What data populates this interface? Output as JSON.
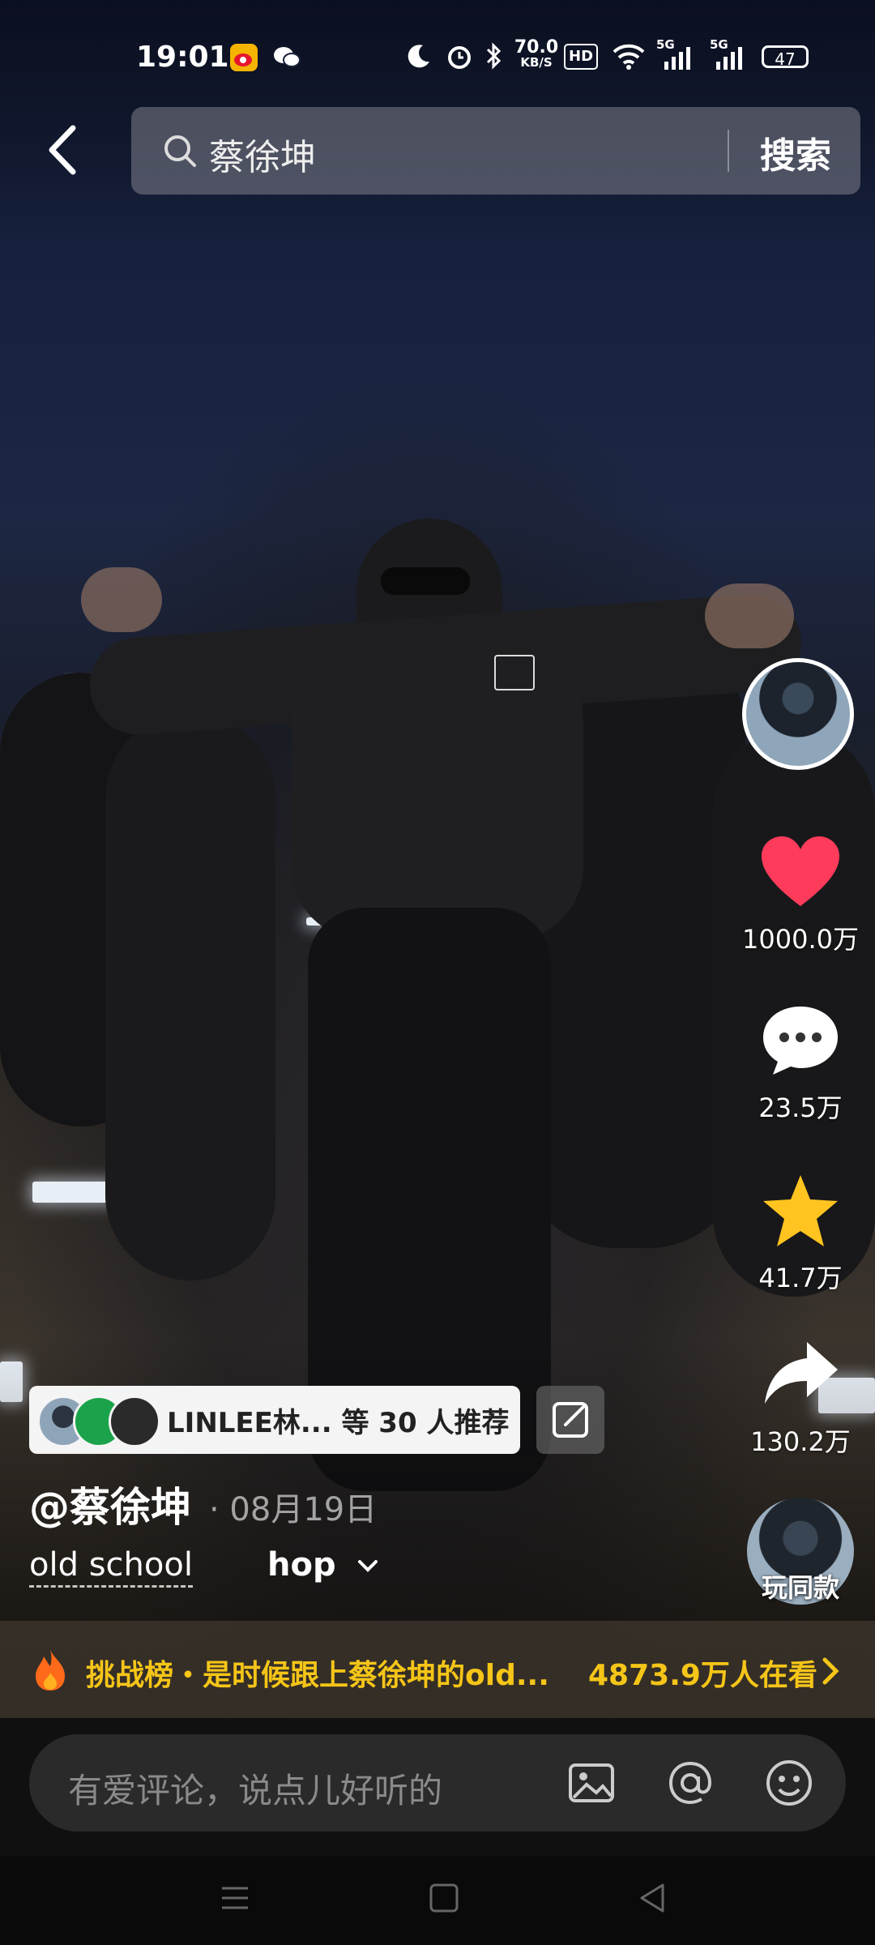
{
  "status_bar": {
    "time": "19:01",
    "net_speed_value": "70.0",
    "net_speed_unit": "KB/S",
    "hd_badge": "HD",
    "signal1": "5G",
    "signal2": "5G",
    "battery": "47",
    "icons": [
      "weibo-icon",
      "wechat-icon",
      "moon-icon",
      "alarm-icon",
      "bluetooth-icon",
      "wifi-icon",
      "signal-icon"
    ]
  },
  "search": {
    "query": "蔡徐坤",
    "button_label": "搜索"
  },
  "actions": {
    "likes": "1000.0万",
    "comments": "23.5万",
    "favorites": "41.7万",
    "shares": "130.2万"
  },
  "colors": {
    "like": "#ff3b5c",
    "favorite": "#ffc41f",
    "banner_text": "#f5c518"
  },
  "recommend": {
    "text": "LINLEE林... 等 30 人推荐"
  },
  "post": {
    "author": "@蔡徐坤",
    "date": "· 08月19日",
    "tag": "old school",
    "music": "hop"
  },
  "play_same": {
    "label": "玩同款"
  },
  "banner": {
    "text": "挑战榜・是时候跟上蔡徐坤的old...",
    "viewers": "4873.9万人在看"
  },
  "comment": {
    "placeholder": "有爱评论，说点儿好听的"
  }
}
